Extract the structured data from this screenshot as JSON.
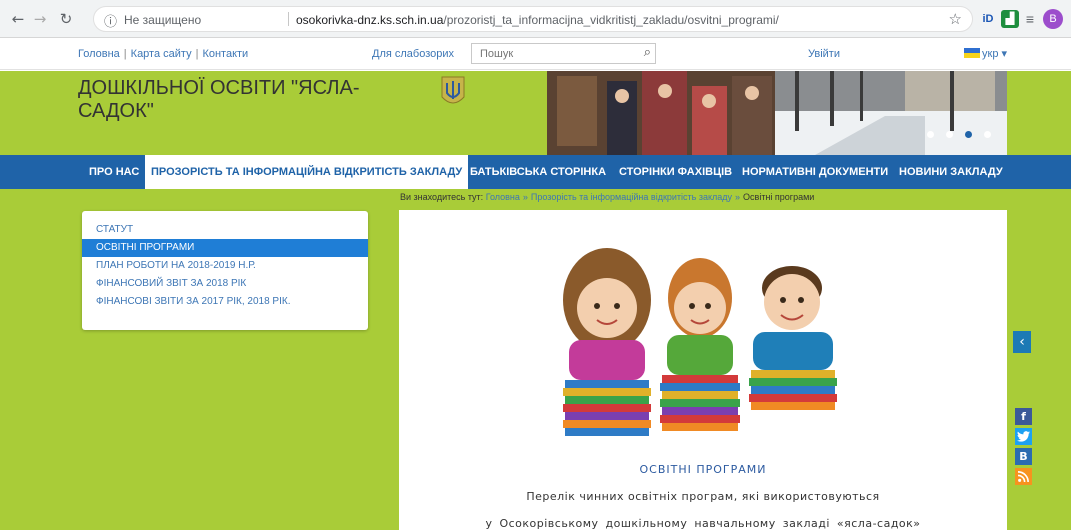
{
  "browser": {
    "security_label": "Не защищено",
    "url_domain": "osokorivka-dnz.ks.sch.in.ua",
    "url_path": "/prozoristj_ta_informacijna_vidkritistj_zakladu/osvitni_programi/",
    "avatar_letter": "B",
    "icons": [
      "back-icon",
      "forward-icon",
      "reload-icon",
      "info-icon",
      "star-icon",
      "ext-id-icon",
      "ext-green-icon",
      "reading-list-icon"
    ]
  },
  "topbar": {
    "links": [
      "Головна",
      "Карта сайту",
      "Контакти"
    ],
    "vision_link": "Для слабозорих",
    "search_placeholder": "Пошук",
    "login": "Увійти",
    "language": "укр"
  },
  "header": {
    "title": "ДОШКІЛЬНОЇ ОСВІТИ \"ЯСЛА-САДОК\""
  },
  "nav": {
    "items": [
      "ПРО НАС",
      "ПРОЗОРІСТЬ ТА ІНФОРМАЦІЙНА ВІДКРИТІСТЬ ЗАКЛАДУ",
      "БАТЬКІВСЬКА СТОРІНКА",
      "СТОРІНКИ ФАХІВЦІВ",
      "НОРМАТИВНІ ДОКУМЕНТИ",
      "НОВИНИ ЗАКЛАДУ"
    ],
    "active_index": 1
  },
  "breadcrumb": {
    "prefix": "Ви знаходитесь тут:",
    "items": [
      "Головна",
      "Прозорість та інформаційна відкритість закладу",
      "Освітні програми"
    ]
  },
  "sidebar": {
    "items": [
      "СТАТУТ",
      "ОСВІТНІ ПРОГРАМИ",
      "ПЛАН РОБОТИ НА 2018-2019 Н.Р.",
      "ФІНАНСОВИЙ ЗВІТ ЗА 2018 РІК",
      "ФІНАНСОВІ ЗВІТИ ЗА 2017 РІК, 2018 РІК."
    ],
    "active_index": 1
  },
  "main": {
    "heading": "ОСВІТНІ ПРОГРАМИ",
    "line1": "Перелік чинних освітніх програм, які використовуються",
    "line2": "у Осокорівському дошкільному навчальному закладі «ясла-садок»"
  },
  "social": {
    "labels": [
      "f",
      "",
      "B",
      ""
    ],
    "colors": {
      "facebook": "#3b5998",
      "twitter": "#1da1f2",
      "vk": "#2b6cb0",
      "rss": "#f7931e"
    }
  },
  "colors": {
    "header_green": "#a9cc38",
    "nav_blue": "#1f63a8",
    "link_blue": "#3d76b5",
    "active_blue": "#1f7ed6"
  }
}
